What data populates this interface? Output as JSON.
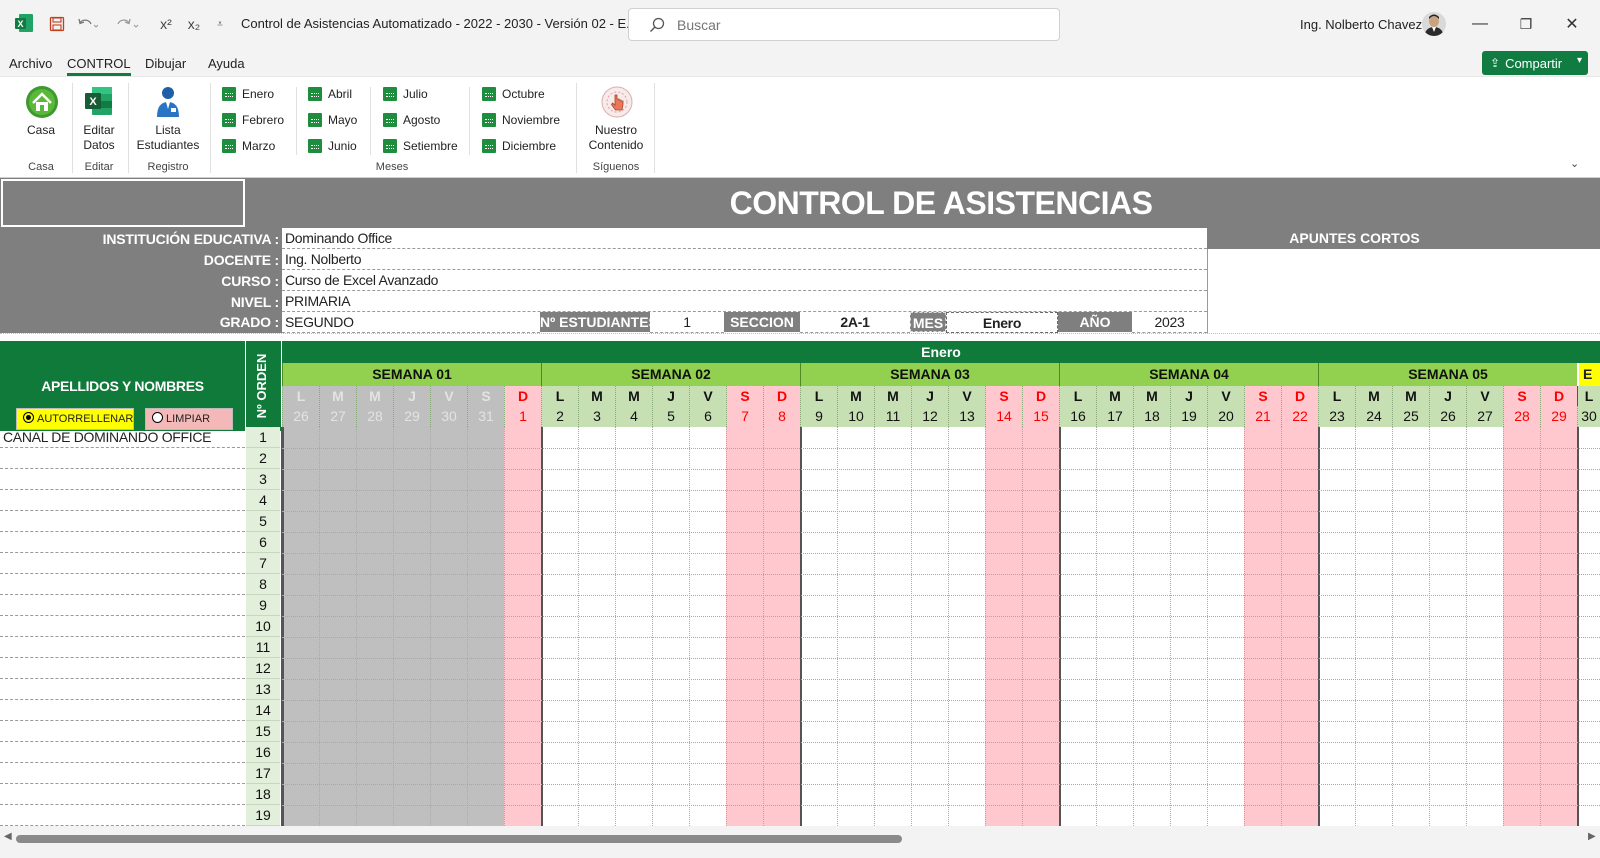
{
  "titlebar": {
    "doc_title": "Control de Asistencias Automatizado - 2022 - 2030 - Versión 02  -  E...",
    "search_placeholder": "Buscar",
    "user_name": "Ing. Nolberto Chavez",
    "superscript_label": "x²",
    "subscript_label": "x₂",
    "minimize": "—",
    "restore": "❐",
    "close": "✕"
  },
  "menu": {
    "tabs": [
      "Archivo",
      "CONTROL",
      "Dibujar",
      "Ayuda"
    ],
    "active": "CONTROL",
    "share_label": "Compartir"
  },
  "ribbon": {
    "casa": {
      "button": "Casa",
      "group": "Casa"
    },
    "editar": {
      "button_line1": "Editar",
      "button_line2": "Datos",
      "group": "Editar"
    },
    "registro": {
      "button_line1": "Lista",
      "button_line2": "Estudiantes",
      "group": "Registro"
    },
    "meses": {
      "group": "Meses",
      "items": [
        "Enero",
        "Febrero",
        "Marzo",
        "Abril",
        "Mayo",
        "Junio",
        "Julio",
        "Agosto",
        "Setiembre",
        "Octubre",
        "Noviembre",
        "Diciembre"
      ]
    },
    "siguenos": {
      "button_line1": "Nuestro",
      "button_line2": "Contenido",
      "group": "Síguenos"
    }
  },
  "sheet": {
    "title": "CONTROL DE ASISTENCIAS",
    "labels": {
      "institucion": "INSTITUCIÓN EDUCATIVA :",
      "docente": "DOCENTE :",
      "curso": "CURSO :",
      "nivel": "NIVEL :",
      "grado": "GRADO :",
      "n_estudiantes": "Nº ESTUDIANTES",
      "seccion": "SECCION",
      "mes": "MES",
      "anio": "AÑO",
      "apuntes": "APUNTES CORTOS"
    },
    "values": {
      "institucion": "Dominando Office",
      "docente": "Ing. Nolberto",
      "curso": "Curso de Excel Avanzado",
      "nivel": "PRIMARIA",
      "grado": "SEGUNDO",
      "n_estudiantes": "1",
      "seccion": "2A-1",
      "mes": "Enero",
      "anio": "2023"
    },
    "roster": {
      "names_header": "APELLIDOS Y NOMBRES",
      "order_header": "Nº ORDEN",
      "autofill_label": "AUTORRELLENAR",
      "clear_label": "LIMPIAR",
      "month_header": "Enero",
      "names": [
        "CANAL DE DOMINANDO OFFICE"
      ],
      "orders": [
        "1",
        "2",
        "3",
        "4",
        "5",
        "6",
        "7",
        "8",
        "9",
        "10",
        "11",
        "12",
        "13",
        "14",
        "15",
        "16",
        "17",
        "18",
        "19"
      ]
    },
    "weeks": [
      {
        "label": "SEMANA 01",
        "days": [
          [
            "L",
            "26"
          ],
          [
            "M",
            "27"
          ],
          [
            "M",
            "28"
          ],
          [
            "J",
            "29"
          ],
          [
            "V",
            "30"
          ],
          [
            "S",
            "31"
          ],
          [
            "D",
            "1"
          ]
        ]
      },
      {
        "label": "SEMANA 02",
        "days": [
          [
            "L",
            "2"
          ],
          [
            "M",
            "3"
          ],
          [
            "M",
            "4"
          ],
          [
            "J",
            "5"
          ],
          [
            "V",
            "6"
          ],
          [
            "S",
            "7"
          ],
          [
            "D",
            "8"
          ]
        ]
      },
      {
        "label": "SEMANA 03",
        "days": [
          [
            "L",
            "9"
          ],
          [
            "M",
            "10"
          ],
          [
            "M",
            "11"
          ],
          [
            "J",
            "12"
          ],
          [
            "V",
            "13"
          ],
          [
            "S",
            "14"
          ],
          [
            "D",
            "15"
          ]
        ]
      },
      {
        "label": "SEMANA 04",
        "days": [
          [
            "L",
            "16"
          ],
          [
            "M",
            "17"
          ],
          [
            "M",
            "18"
          ],
          [
            "J",
            "19"
          ],
          [
            "V",
            "20"
          ],
          [
            "S",
            "21"
          ],
          [
            "D",
            "22"
          ]
        ]
      },
      {
        "label": "SEMANA 05",
        "days": [
          [
            "L",
            "23"
          ],
          [
            "M",
            "24"
          ],
          [
            "M",
            "25"
          ],
          [
            "J",
            "26"
          ],
          [
            "V",
            "27"
          ],
          [
            "S",
            "28"
          ],
          [
            "D",
            "29"
          ]
        ]
      }
    ],
    "extra_col": {
      "header": "E",
      "dow": "L",
      "day": "30"
    },
    "colors": {
      "header_gray": "#7f7f7f",
      "dark_green": "#0f7a3a",
      "light_green": "#92d050",
      "weekend_red": "#ff0000",
      "weekend_fill": "#ffc7ce",
      "outside_month_fill": "#bfbfbf"
    }
  }
}
